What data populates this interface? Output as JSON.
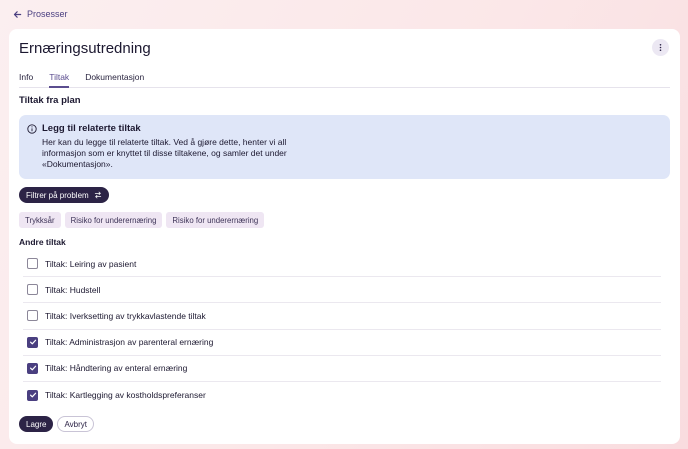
{
  "breadcrumb": {
    "back_label": "Prosesser"
  },
  "page": {
    "title": "Ernæringsutredning"
  },
  "tabs": [
    {
      "label": "Info",
      "active": false
    },
    {
      "label": "Tiltak",
      "active": true
    },
    {
      "label": "Dokumentasjon",
      "active": false
    }
  ],
  "section": {
    "title": "Tiltak fra plan"
  },
  "info_box": {
    "title": "Legg til relaterte tiltak",
    "text": "Her kan du legge til relaterte tiltak. Ved å gjøre dette, henter vi all informasjon som er knyttet til disse tiltakene, og samler det under «Dokumentasjon»."
  },
  "filter": {
    "label": "Filtrer på problem"
  },
  "chips": [
    "Trykksår",
    "Risiko for underernæring",
    "Risiko for underernæring"
  ],
  "other": {
    "title": "Andre tiltak",
    "items": [
      {
        "label": "Tiltak: Leiring av pasient",
        "checked": false
      },
      {
        "label": "Tiltak: Hudstell",
        "checked": false
      },
      {
        "label": "Tiltak: Iverksetting av trykkavlastende tiltak",
        "checked": false
      },
      {
        "label": "Tiltak: Administrasjon av parenteral ernæring",
        "checked": true
      },
      {
        "label": "Tiltak: Håndtering av enteral ernæring",
        "checked": true
      },
      {
        "label": "Tiltak: Kartlegging av kostholdspreferanser",
        "checked": true
      }
    ]
  },
  "actions": {
    "save_label": "Lagre",
    "cancel_label": "Avbryt"
  },
  "colors": {
    "accent": "#4a3f80",
    "dark_button": "#2c2346",
    "info_bg": "#dfe6f8",
    "chip_bg": "#efe6f3"
  }
}
